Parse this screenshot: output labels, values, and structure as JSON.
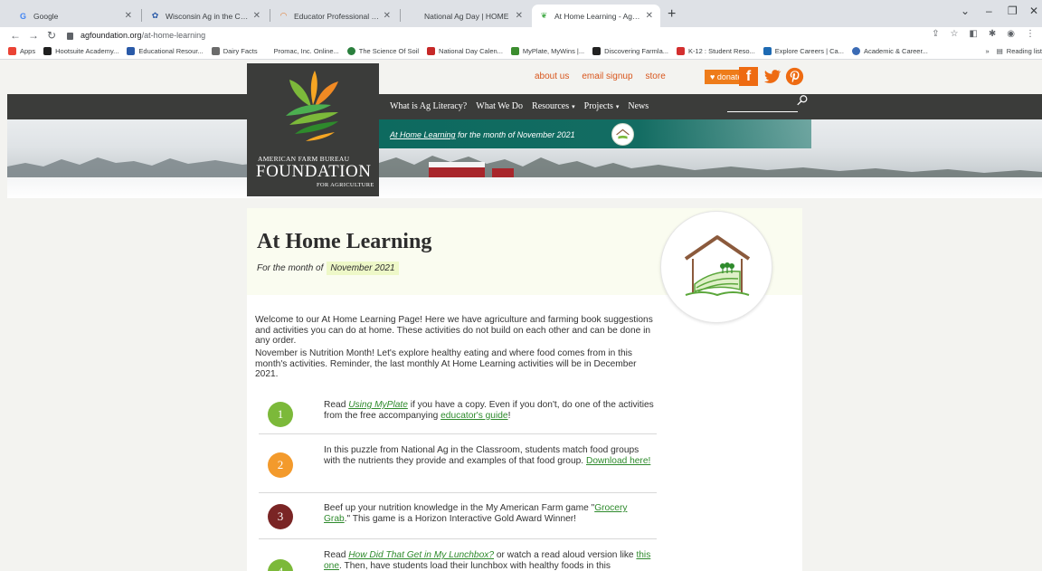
{
  "browser": {
    "tabs": [
      {
        "label": "Google",
        "icon": "google-icon",
        "active": false
      },
      {
        "label": "Wisconsin Ag in the Classroom | F",
        "icon": "wisconsin-ag-icon",
        "active": false
      },
      {
        "label": "Educator Professional Developm",
        "icon": "educator-icon",
        "active": false
      },
      {
        "label": "National Ag Day | HOME",
        "icon": "",
        "active": false
      },
      {
        "label": "At Home Learning - Agriculture F",
        "icon": "foundation-icon",
        "active": true
      }
    ],
    "new_tab": "+",
    "url_domain": "agfoundation.org",
    "url_path": "/at-home-learning",
    "bookmarks": [
      {
        "label": "Apps",
        "color": "#ea4335"
      },
      {
        "label": "Hootsuite Academy...",
        "color": "#1f1f1f"
      },
      {
        "label": "Educational Resour...",
        "color": "#2a5aa8"
      },
      {
        "label": "Dairy Facts",
        "color": "#6b6b6b"
      },
      {
        "label": "Promac, Inc. Online...",
        "color": "#ffffff"
      },
      {
        "label": "The Science Of Soil",
        "color": "#2a7f3d"
      },
      {
        "label": "National Day Calen...",
        "color": "#c62828"
      },
      {
        "label": "MyPlate, MyWins |...",
        "color": "#3c8d2f"
      },
      {
        "label": "Discovering Farmla...",
        "color": "#222222"
      },
      {
        "label": "K-12 : Student Reso...",
        "color": "#d32f2f"
      },
      {
        "label": "Explore Careers | Ca...",
        "color": "#1e6ab3"
      },
      {
        "label": "Academic & Career...",
        "color": "#3b6bb5"
      }
    ],
    "bookmarks_overflow": "»",
    "reading_list": "Reading list"
  },
  "site": {
    "top_links": [
      "about us",
      "email signup",
      "store"
    ],
    "donate_label": "♥ donate",
    "nav": [
      {
        "label": "What is Ag Literacy?",
        "dropdown": false
      },
      {
        "label": "What We Do",
        "dropdown": false
      },
      {
        "label": "Resources",
        "dropdown": true
      },
      {
        "label": "Projects",
        "dropdown": true
      },
      {
        "label": "News",
        "dropdown": false
      }
    ],
    "banner_link": "At Home Learning",
    "banner_rest": " for the month of November 2021",
    "logo_line1": "AMERICAN FARM BUREAU",
    "logo_line2": "FOUNDATION",
    "logo_line3": "FOR AGRICULTURE",
    "colors": {
      "accent_orange": "#ee7c1a",
      "nav_dark": "#3b3c3a",
      "link_green": "#2e8a2c"
    }
  },
  "content": {
    "title": "At Home Learning",
    "subtitle_prefix": "For the month of",
    "month": "November 2021",
    "intro1": "Welcome to our At Home Learning Page! Here we have agriculture and farming book suggestions and activities you can do at home. These activities do not build on each other and can be done in any order.",
    "intro2": "November is Nutrition Month! Let's explore healthy eating and where food comes from in this month's activities. Reminder, the last monthly At Home Learning activities will be in December 2021.",
    "activities": [
      {
        "num": "1",
        "color": "#7cb93a",
        "t1": "Read ",
        "link1": "Using MyPlate",
        "t2": " if you have a copy. Even if you don't, do one of the activities from the free accompanying ",
        "link2": "educator's guide",
        "t3": "!"
      },
      {
        "num": "2",
        "color": "#f39a2c",
        "t1": "In this puzzle from National Ag in the Classroom, students match food groups with the nutrients they provide and examples of that food group. ",
        "link1": "Download here!",
        "t2": "",
        "link2": "",
        "t3": ""
      },
      {
        "num": "3",
        "color": "#7a2525",
        "t1": "Beef up your nutrition knowledge in the My American Farm game \"",
        "link1": "Grocery Grab",
        "t2": ".\" This game is a Horizon Interactive Gold Award Winner!",
        "link2": "",
        "t3": ""
      },
      {
        "num": "4",
        "color": "#7cb93a",
        "t1": "Read ",
        "link1": "How Did That Get in My Lunchbox?",
        "t2": " or watch a read aloud version like ",
        "link2": "this one",
        "t3": ". Then, have students load their lunchbox with healthy foods in this"
      }
    ]
  }
}
